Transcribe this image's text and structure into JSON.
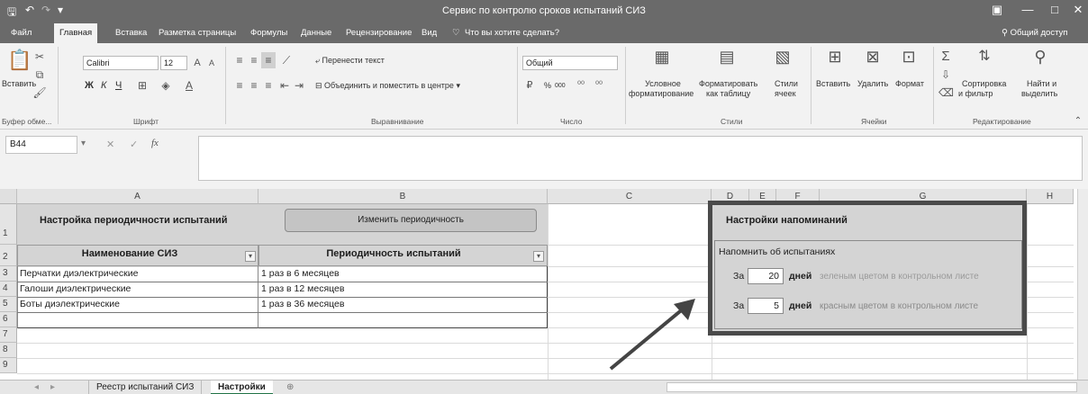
{
  "window": {
    "title": "Сервис по контролю сроков испытаний СИЗ",
    "share_label": "Общий доступ"
  },
  "menu": {
    "tabs": [
      "Файл",
      "Главная",
      "Вставка",
      "Разметка страницы",
      "Формулы",
      "Данные",
      "Рецензирование",
      "Вид"
    ],
    "tell_me": "Что вы хотите сделать?"
  },
  "ribbon": {
    "paste": "Вставить",
    "clipboard_group": "Буфер обме...",
    "font_name": "Calibri",
    "font_size": "12",
    "bold": "Ж",
    "italic": "К",
    "underline": "Ч",
    "font_group": "Шрифт",
    "wrap_text": "Перенести текст",
    "merge_center": "Объединить и поместить в центре",
    "alignment_group": "Выравнивание",
    "number_format": "Общий",
    "percent": "%",
    "thousands": "000",
    "number_group": "Число",
    "conditional_1": "Условное",
    "conditional_2": "форматирование",
    "format_table_1": "Форматировать",
    "format_table_2": "как таблицу",
    "cell_styles_1": "Стили",
    "cell_styles_2": "ячеек",
    "styles_group": "Стили",
    "insert": "Вставить",
    "delete": "Удалить",
    "format": "Формат",
    "cells_group": "Ячейки",
    "sort_1": "Сортировка",
    "sort_2": "и фильтр",
    "find_1": "Найти и",
    "find_2": "выделить",
    "editing_group": "Редактирование"
  },
  "formula_bar": {
    "name_box": "B44",
    "fx": "fx",
    "formula": ""
  },
  "grid": {
    "columns": [
      "A",
      "B",
      "C",
      "D",
      "E",
      "F",
      "G",
      "H"
    ],
    "rows": [
      "1",
      "2",
      "3",
      "4",
      "5",
      "6",
      "7",
      "8",
      "9"
    ]
  },
  "sheet": {
    "settings_title": "Настройка периодичности испытаний",
    "change_button": "Изменить периодичность",
    "col_name_header": "Наименование СИЗ",
    "col_period_header": "Периодичность испытаний",
    "items": [
      {
        "name": "Перчатки диэлектрические",
        "period": "1 раз в 6 месяцев"
      },
      {
        "name": "Галоши диэлектрические",
        "period": "1 раз в 12 месяцев"
      },
      {
        "name": "Боты диэлектрические",
        "period": "1 раз в 36 месяцев"
      }
    ]
  },
  "reminders": {
    "title": "Настройки напоминаний",
    "subtitle": "Напомнить об испытаниях",
    "row1": {
      "prefix": "За",
      "days": "20",
      "unit": "дней",
      "note": "зеленым цветом в контрольном листе"
    },
    "row2": {
      "prefix": "За",
      "days": "5",
      "unit": "дней",
      "note": "красным цветом в контрольном листе"
    }
  },
  "tabs": {
    "sheets": [
      "Реестр испытаний СИЗ",
      "Настройки"
    ],
    "active": "Настройки",
    "add": "⊕"
  },
  "colors": {
    "titlebar": "#6a6a6a",
    "panel": "#d4d4d4",
    "highlight_border": "#4a4a4a",
    "green_note": "#9a9a9a",
    "red_note": "#8a8a8a"
  }
}
